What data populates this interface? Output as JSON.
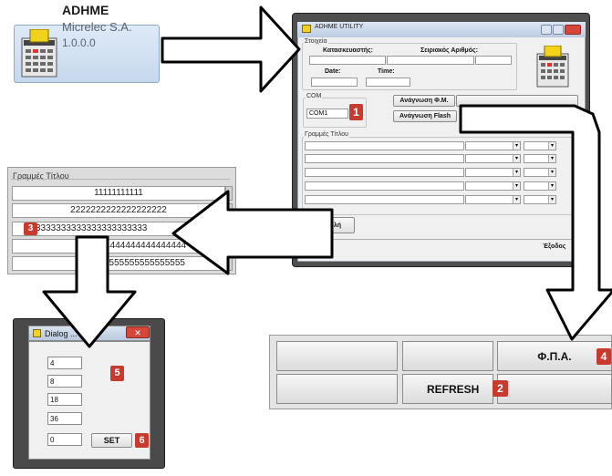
{
  "app_tile": {
    "name": "ADHME",
    "company": "Micrelec S.A.",
    "version": "1.0.0.0"
  },
  "window": {
    "title": "ADHME UTILITY",
    "group_info": "Στοιχεία",
    "manufacturer_label": "Κατασκευαστής:",
    "serial_label": "Σειριακός Αριθμός:",
    "date_label": "Date:",
    "time_label": "Time:",
    "group_com": "COM",
    "com_value": "COM1",
    "read_fm_button": "Ανάγνωση Φ.Μ.",
    "read_flash_button": "Ανάγνωση Flash",
    "group_header_lines": "Γραμμές Τίτλου",
    "send_button": "...ντολή",
    "exit_button": "Έξοδος"
  },
  "header_lines_panel": {
    "title": "Γραμμές Τίτλου",
    "lines": [
      "11111111111",
      "2222222222222222222",
      "3333333333333333333333",
      "444444444444444444",
      "5555555555555555"
    ]
  },
  "dialog": {
    "title": "Dialog ...",
    "fields": [
      "4",
      "8",
      "18",
      "36",
      "0"
    ],
    "set_button": "SET"
  },
  "bottom_panel": {
    "vat_button": "Φ.Π.Α.",
    "refresh_button": "REFRESH"
  },
  "badges": [
    "1",
    "2",
    "3",
    "4",
    "5",
    "6"
  ],
  "colors": {
    "badge": "#c93a2e",
    "arrow_fill": "#ffffff",
    "arrow_stroke": "#000000"
  }
}
